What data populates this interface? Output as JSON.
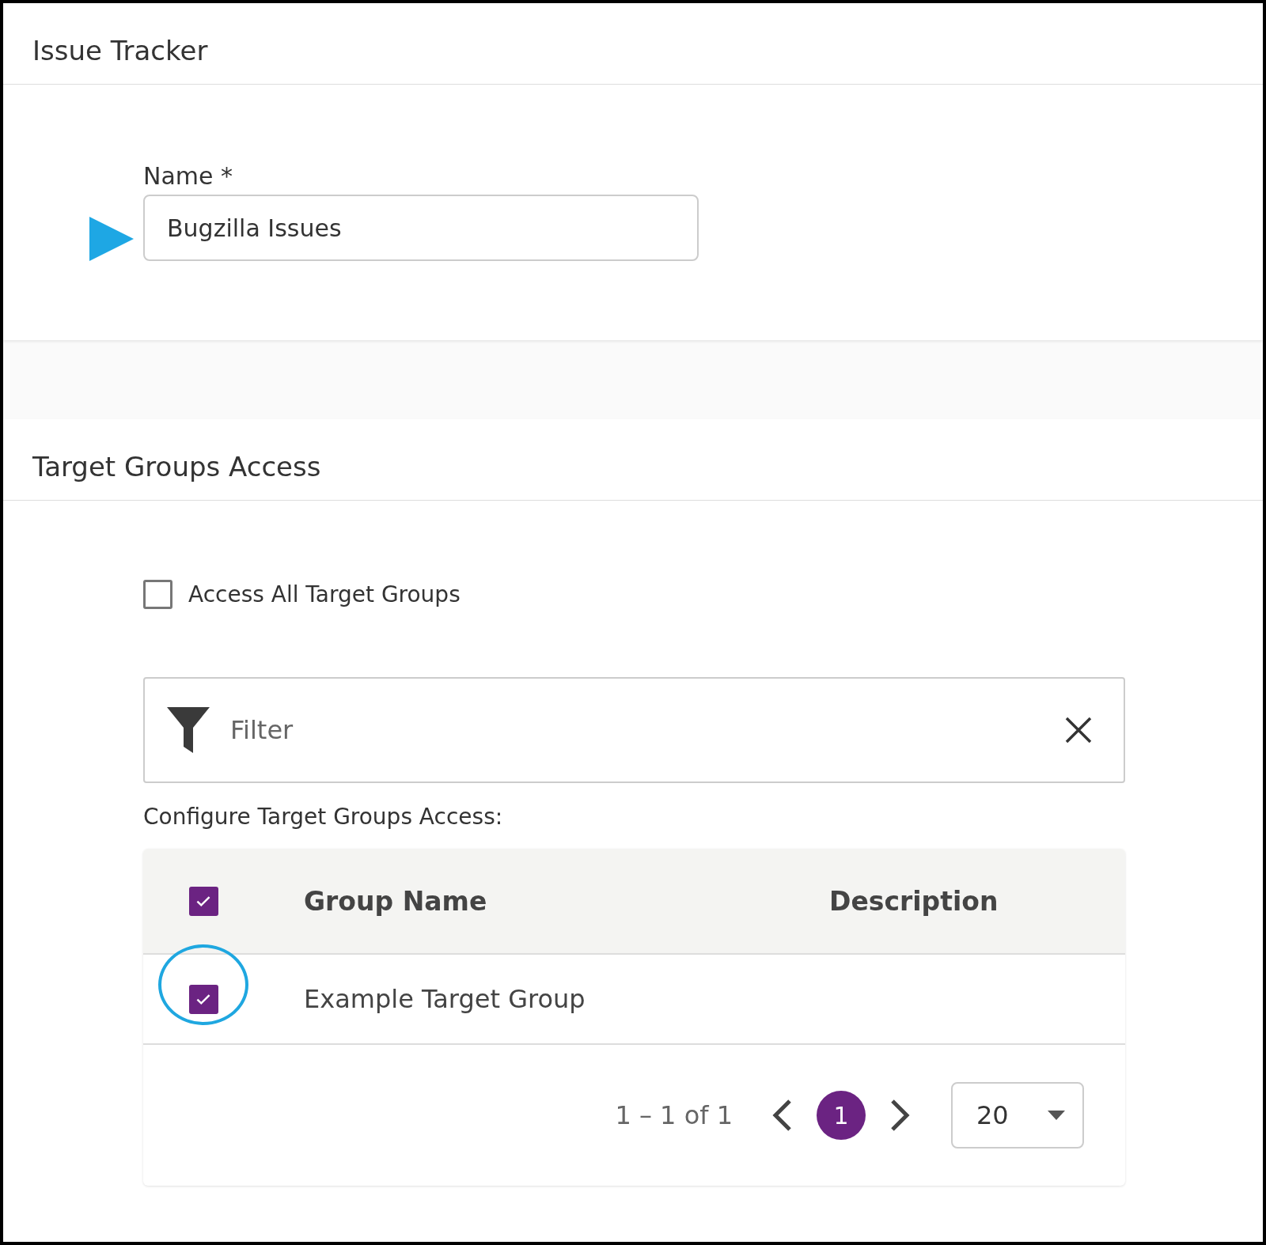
{
  "header": {
    "title": "Issue Tracker"
  },
  "name_field": {
    "label": "Name *",
    "value": "Bugzilla Issues"
  },
  "access_section": {
    "title": "Target Groups Access",
    "access_all": {
      "label": "Access All Target Groups",
      "checked": false
    },
    "filter": {
      "placeholder": "Filter"
    },
    "configure_label": "Configure Target Groups Access:",
    "table": {
      "select_all_checked": true,
      "columns": [
        "Group Name",
        "Description"
      ],
      "rows": [
        {
          "group_name": "Example Target Group",
          "checked": true
        }
      ]
    },
    "pagination": {
      "range": "1 – 1 of 1",
      "pages": [
        {
          "label": "1",
          "selected": true
        }
      ],
      "page_size": "20"
    }
  }
}
